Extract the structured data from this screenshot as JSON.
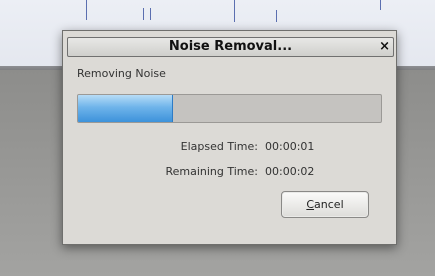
{
  "dialog": {
    "title": "Noise Removal...",
    "close_glyph": "×",
    "status_text": "Removing Noise",
    "progress_fraction": 0.31,
    "elapsed_label": "Elapsed Time:",
    "elapsed_value": "00:00:01",
    "remaining_label": "Remaining Time:",
    "remaining_value": "00:00:02",
    "cancel_mnemonic": "C",
    "cancel_rest": "ancel"
  },
  "colors": {
    "progress_fill": "#4fa3e3",
    "dialog_bg": "#dcdad6"
  }
}
